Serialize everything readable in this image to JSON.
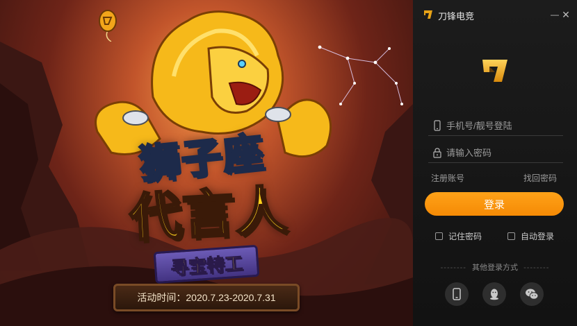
{
  "banner": {
    "title_line1": "狮子座",
    "title_line2": "代言人",
    "subtitle": "寻宝特工",
    "event_time": "活动时间：2020.7.23-2020.7.31"
  },
  "titlebar": {
    "app_name": "刀锋电竞",
    "minimize_glyph": "—",
    "close_glyph": "✕"
  },
  "login": {
    "phone_placeholder": "手机号/靓号登陆",
    "password_placeholder": "请输入密码",
    "register_label": "注册账号",
    "forgot_label": "找回密码",
    "login_label": "登录",
    "remember_label": "记住密码",
    "auto_login_label": "自动登录",
    "other_methods_label": "其他登录方式",
    "other_methods_dashes": "--------"
  },
  "colors": {
    "accent": "#f7930e",
    "panel_bg": "#161616",
    "brand_gold": "#e8a317"
  },
  "icons": {
    "phone_field": "mobile-phone-icon",
    "password_field": "lock-icon",
    "social": [
      "mobile-phone-icon",
      "qq-penguin-icon",
      "wechat-icon"
    ]
  }
}
